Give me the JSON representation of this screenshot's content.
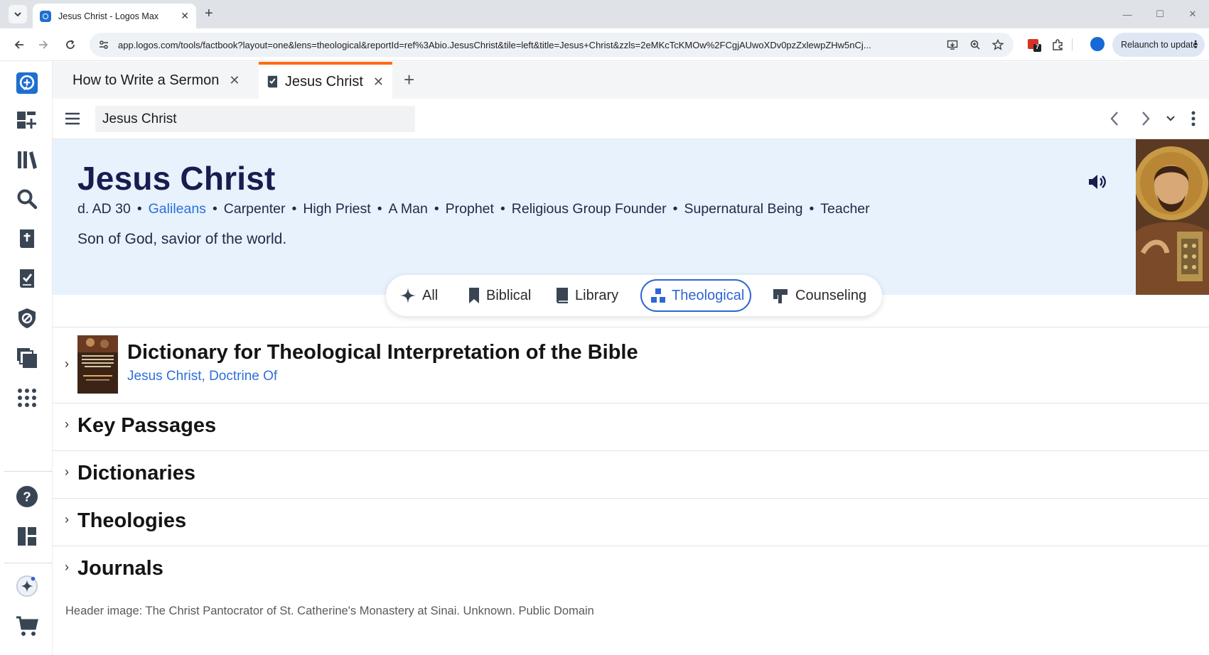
{
  "browser": {
    "tab_title": "Jesus Christ - Logos Max",
    "url": "app.logos.com/tools/factbook?layout=one&lens=theological&reportId=ref%3Abio.JesusChrist&tile=left&title=Jesus+Christ&zzls=2eMKcTcKMOw%2FCgjAUwoXDv0pzZxlewpZHw5nCj...",
    "relaunch_label": "Relaunch to update",
    "extension_badge": "7"
  },
  "app_tabs": [
    {
      "title": "How to Write a Sermon"
    },
    {
      "title": "Jesus Christ"
    }
  ],
  "panel": {
    "search_value": "Jesus Christ"
  },
  "hero": {
    "title": "Jesus Christ",
    "meta": [
      "d. AD 30",
      "Galileans",
      "Carpenter",
      "High Priest",
      "A Man",
      "Prophet",
      "Religious Group Founder",
      "Supernatural Being",
      "Teacher"
    ],
    "description": "Son of God, savior of the world."
  },
  "lenses": [
    {
      "label": "All",
      "icon": "sparkle-icon"
    },
    {
      "label": "Biblical",
      "icon": "bookmark-icon"
    },
    {
      "label": "Library",
      "icon": "book-icon"
    },
    {
      "label": "Theological",
      "icon": "theology-icon"
    },
    {
      "label": "Counseling",
      "icon": "signpost-icon"
    }
  ],
  "selected_lens": "Theological",
  "resource": {
    "title": "Dictionary for Theological Interpretation of the Bible",
    "link": "Jesus Christ, Doctrine Of"
  },
  "sections": [
    "Key Passages",
    "Dictionaries",
    "Theologies",
    "Journals"
  ],
  "credit": "Header image: The Christ Pantocrator of St. Catherine's Monastery at Sinai. Unknown. Public Domain",
  "colors": {
    "accent": "#2f66d4",
    "hero_bg": "#e7f2fd",
    "active_tab_indicator": "#ff6a13",
    "title_navy": "#1b1b4f"
  }
}
